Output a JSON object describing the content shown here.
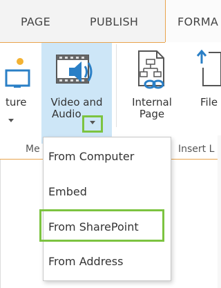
{
  "tabs": {
    "page": "PAGE",
    "publish": "PUBLISH",
    "format": "FORMA"
  },
  "ribbon": {
    "picture_label_1": "ture",
    "video_label_1": "Video and",
    "video_label_2": "Audio",
    "internal_label_1": "Internal",
    "internal_label_2": "Page",
    "file_label_1": "File",
    "group_media": "Me",
    "group_insert": "Insert L"
  },
  "menu": {
    "items": [
      {
        "label": "From Computer"
      },
      {
        "label": "Embed"
      },
      {
        "label": "From SharePoint"
      },
      {
        "label": "From Address"
      }
    ]
  },
  "colors": {
    "accent_orange": "#e8a34b",
    "highlight_green": "#7cc340",
    "selected_blue": "#cde6f7"
  }
}
